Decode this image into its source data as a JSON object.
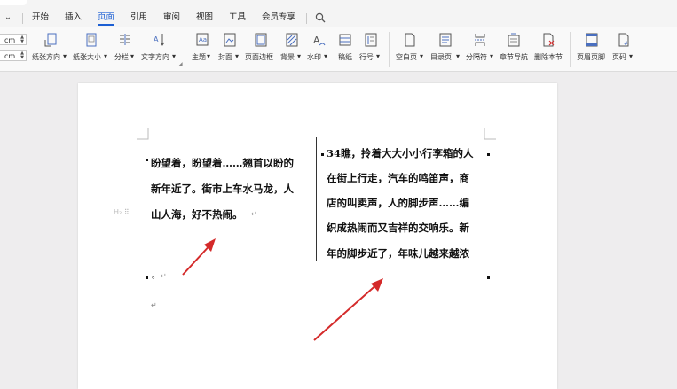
{
  "menu": {
    "collapse": "⌄",
    "tabs": [
      "开始",
      "插入",
      "页面",
      "引用",
      "审阅",
      "视图",
      "工具",
      "会员专享"
    ],
    "active_tab": "页面"
  },
  "ribbon": {
    "unit_top": "cm",
    "unit_bottom": "cm",
    "group1": [
      "纸张方向",
      "纸张大小",
      "分栏",
      "文字方向"
    ],
    "group2": [
      "主题",
      "封面",
      "页面边框",
      "背景",
      "水印",
      "稿纸",
      "行号"
    ],
    "group3": [
      "空白页",
      "目录页",
      "分隔符",
      "章节导航",
      "删除本节"
    ],
    "group4": [
      "页眉页脚",
      "页码"
    ]
  },
  "document": {
    "left_lines": [
      "盼望着，盼望着……翘首以盼的",
      "新年近了。街市上车水马龙，人",
      "山人海，好不热闹。"
    ],
    "right_lines": [
      "34瞧，拎着大大小小行李箱的人",
      "在街上行走，汽车的鸣笛声，商",
      "店的叫卖声，人的脚步声……编",
      "织成热闹而又吉祥的交响乐。新",
      "年的脚步近了，年味儿越来越浓"
    ],
    "after_mark": "。",
    "paragraph_mark": "↵",
    "heading_marker": "H₂",
    "handle": "⠿"
  },
  "annotations": {
    "arrow_color": "#d42a2a"
  }
}
